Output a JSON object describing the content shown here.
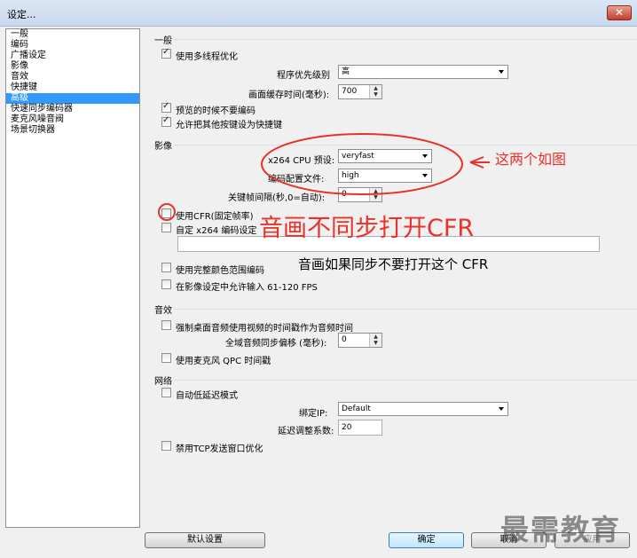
{
  "window": {
    "title": "设定...",
    "close_label": "✕"
  },
  "sidebar": {
    "items": [
      {
        "label": "一般"
      },
      {
        "label": "编码"
      },
      {
        "label": "广播设定"
      },
      {
        "label": "影像"
      },
      {
        "label": "音效"
      },
      {
        "label": "快捷键"
      },
      {
        "label": "高级",
        "selected": true
      },
      {
        "label": "快速同步编码器"
      },
      {
        "label": "麦克风噪音阀"
      },
      {
        "label": "场景切换器"
      }
    ]
  },
  "general": {
    "title": "一般",
    "multithread": {
      "label": "使用多线程优化",
      "checked": true
    },
    "priority": {
      "label": "程序优先级别",
      "value": "高"
    },
    "buffer": {
      "label": "画面缓存时间(毫秒):",
      "value": "700"
    },
    "no_encode_preview": {
      "label": "预览的时候不要编码",
      "checked": true
    },
    "allow_hotkeys": {
      "label": "允许把其他按键设为快捷键",
      "checked": true
    }
  },
  "video": {
    "title": "影像",
    "preset": {
      "label": "x264 CPU 预设:",
      "value": "veryfast"
    },
    "profile": {
      "label": "编码配置文件:",
      "value": "high"
    },
    "keyframe": {
      "label": "关键帧间隔(秒,0=自动):",
      "value": "0"
    },
    "cfr": {
      "label": "使用CFR(固定帧率)",
      "checked": false
    },
    "custom_x264": {
      "label": "自定 x264 编码设定",
      "checked": false,
      "value": ""
    },
    "full_range": {
      "label": "使用完整颜色范围编码",
      "checked": false
    },
    "allow_fps": {
      "label": "在影像设定中允许输入 61-120 FPS",
      "checked": false
    }
  },
  "audio": {
    "title": "音效",
    "force_desktop": {
      "label": "强制桌面音频使用视频的时间戳作为音频时间",
      "checked": false
    },
    "sync_offset": {
      "label": "全域音频同步偏移 (毫秒):",
      "value": "0"
    },
    "mic_qpc": {
      "label": "使用麦克风 QPC 时间戳",
      "checked": false
    }
  },
  "network": {
    "title": "网络",
    "low_latency": {
      "label": "自动低延迟模式",
      "checked": false
    },
    "bind_ip": {
      "label": "绑定IP:",
      "value": "Default"
    },
    "latency_factor": {
      "label": "延迟调整系数:",
      "value": "20"
    },
    "disable_tcp": {
      "label": "禁用TCP发送窗口优化",
      "checked": false
    }
  },
  "buttons": {
    "defaults": "默认设置",
    "ok": "确定",
    "cancel": "取消",
    "apply": "应用"
  },
  "annotations": {
    "two_like_image": "这两个如图",
    "cfr_note": "音画不同步打开CFR",
    "sync_note": "音画如果同步不要打开这个 CFR"
  },
  "watermark": "最需教育",
  "colors": {
    "annotation": "#e8322a",
    "selection": "#3399ff"
  }
}
